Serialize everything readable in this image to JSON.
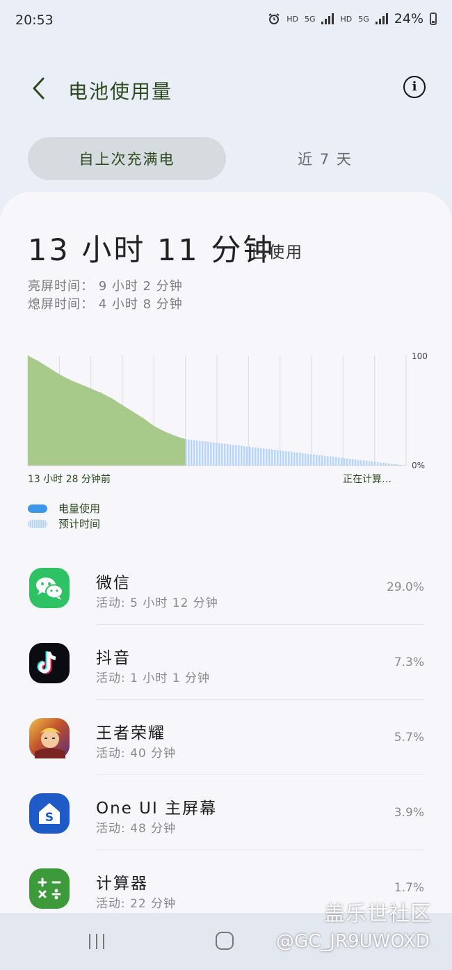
{
  "status_bar": {
    "time": "20:53",
    "battery_percent": "24%",
    "hd_label": "HD",
    "network_label": "5G"
  },
  "header": {
    "title": "电池使用量"
  },
  "tabs": [
    {
      "label": "自上次充满电",
      "selected": true
    },
    {
      "label": "近 7 天",
      "selected": false
    }
  ],
  "summary": {
    "used_time": "13 小时 11 分钟",
    "used_suffix": "已使用",
    "screen_on": "亮屏时间： 9 小时 2 分钟",
    "screen_off": "熄屏时间： 4 小时 8 分钟"
  },
  "chart_data": {
    "type": "area",
    "y_tick_top": "100",
    "y_tick_bottom": "0%",
    "ylim": [
      0,
      100
    ],
    "x_start_label": "13 小时 28 分钟前",
    "x_end_label": "正在计算…",
    "grid": "vertical",
    "series": [
      {
        "name": "电量使用",
        "color": "#a7c98a",
        "x": [
          0,
          1,
          2,
          3,
          4,
          5,
          6,
          7,
          8,
          9,
          10,
          11,
          12,
          13,
          14,
          15
        ],
        "values": [
          100,
          95,
          89,
          83,
          78,
          74,
          70,
          66,
          61,
          55,
          49,
          43,
          36,
          31,
          27,
          24
        ]
      },
      {
        "name": "预计时间",
        "color": "#b9d6f6",
        "x": [
          15,
          16,
          17,
          18,
          19,
          20,
          21,
          22,
          23,
          24,
          25,
          26,
          27,
          28,
          29,
          30,
          31,
          32,
          33,
          34,
          35,
          36
        ],
        "values": [
          24,
          22.9,
          21.7,
          20.6,
          19.4,
          18.3,
          17.1,
          16,
          14.9,
          13.7,
          12.6,
          11.4,
          10.3,
          9.1,
          8,
          6.9,
          5.7,
          4.6,
          3.4,
          2.3,
          1.1,
          0
        ]
      }
    ]
  },
  "legend": [
    {
      "label": "电量使用",
      "color": "#3d97e9"
    },
    {
      "label": "预计时间",
      "color": "#b9d6f6"
    }
  ],
  "apps": [
    {
      "name": "微信",
      "activity": "活动: 5 小时 12 分钟",
      "percent": "29.0%",
      "icon": "wechat-icon",
      "color": "#2ec264"
    },
    {
      "name": "抖音",
      "activity": "活动: 1 小时 1 分钟",
      "percent": "7.3%",
      "icon": "douyin-icon",
      "color": "#0b0b12"
    },
    {
      "name": "王者荣耀",
      "activity": "活动: 40 分钟",
      "percent": "5.7%",
      "icon": "honor-of-kings-icon",
      "color": "#c0532c"
    },
    {
      "name": "One UI 主屏幕",
      "activity": "活动: 48 分钟",
      "percent": "3.9%",
      "icon": "oneui-home-icon",
      "color": "#1e5bc6"
    },
    {
      "name": "计算器",
      "activity": "活动: 22 分钟",
      "percent": "1.7%",
      "icon": "calculator-icon",
      "color": "#3d9a3a"
    }
  ],
  "watermark": {
    "title": "盖乐世社区",
    "id": "@GC_JR9UWOXD"
  }
}
